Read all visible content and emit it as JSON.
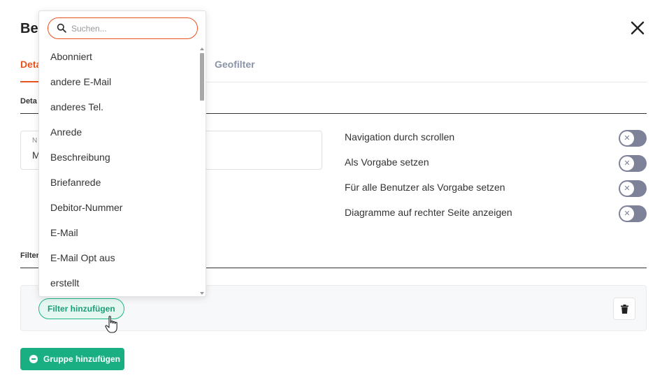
{
  "modal": {
    "title": "Ber",
    "close_icon": "close-icon"
  },
  "tabs": [
    {
      "label": "Deta",
      "active": true
    },
    {
      "label": "Geofilter",
      "active": false
    }
  ],
  "details_section": {
    "label": "Deta"
  },
  "name_field": {
    "label": "N",
    "value": "M"
  },
  "toggles": [
    {
      "label": "Navigation durch scrollen",
      "checked": false
    },
    {
      "label": "Als Vorgabe setzen",
      "checked": false
    },
    {
      "label": "Für alle Benutzer als Vorgabe setzen",
      "checked": false
    },
    {
      "label": "Diagramme auf rechter Seite anzeigen",
      "checked": false
    }
  ],
  "filter_section": {
    "label": "Filter",
    "add_filter_label": "Filter hinzufügen",
    "delete_icon": "trash-icon"
  },
  "add_group_label": "Gruppe hinzufügen",
  "dropdown": {
    "search_placeholder": "Suchen...",
    "search_value": "",
    "options": [
      "Abonniert",
      "andere E-Mail",
      "anderes Tel.",
      "Anrede",
      "Beschreibung",
      "Briefanrede",
      "Debitor-Nummer",
      "E-Mail",
      "E-Mail Opt aus",
      "erstellt"
    ]
  },
  "colors": {
    "accent": "#e8541e",
    "primary_green": "#1aaf82",
    "toggle_off": "#7e8299"
  }
}
